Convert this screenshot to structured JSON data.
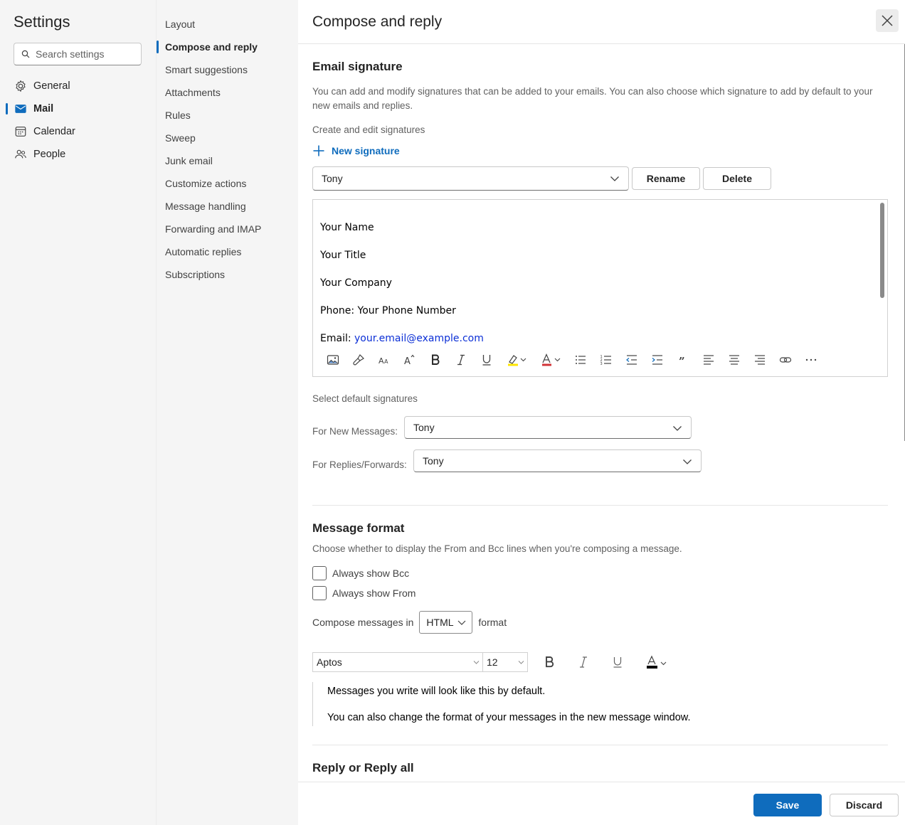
{
  "sidebar": {
    "title": "Settings",
    "search_placeholder": "Search settings",
    "items": [
      {
        "label": "General",
        "icon": "gear-icon"
      },
      {
        "label": "Mail",
        "icon": "mail-icon"
      },
      {
        "label": "Calendar",
        "icon": "calendar-icon"
      },
      {
        "label": "People",
        "icon": "people-icon"
      }
    ]
  },
  "subnav": {
    "items": [
      "Layout",
      "Compose and reply",
      "Smart suggestions",
      "Attachments",
      "Rules",
      "Sweep",
      "Junk email",
      "Customize actions",
      "Message handling",
      "Forwarding and IMAP",
      "Automatic replies",
      "Subscriptions"
    ],
    "active": "Compose and reply"
  },
  "main": {
    "title": "Compose and reply",
    "signature": {
      "heading": "Email signature",
      "description": "You can add and modify signatures that can be added to your emails. You can also choose which signature to add by default to your new emails and replies.",
      "create_label": "Create and edit signatures",
      "new_signature": "New signature",
      "selected": "Tony",
      "rename": "Rename",
      "delete": "Delete",
      "lines": [
        "Your Name",
        "Your Title",
        "Your Company",
        "Phone: Your Phone Number"
      ],
      "email_prefix": "Email: ",
      "email_value": "your.email@example.com",
      "defaults_label": "Select default signatures",
      "new_messages_label": "For New Messages:",
      "new_messages_value": "Tony",
      "replies_label": "For Replies/Forwards:",
      "replies_value": "Tony"
    },
    "format": {
      "heading": "Message format",
      "description": "Choose whether to display the From and Bcc lines when you're composing a message.",
      "show_bcc": "Always show Bcc",
      "show_from": "Always show From",
      "compose_prefix": "Compose messages in",
      "compose_value": "HTML",
      "compose_suffix": "format",
      "font": "Aptos",
      "size": "12",
      "preview_line1": "Messages you write will look like this by default.",
      "preview_line2": "You can also change the format of your messages in the new message window."
    },
    "reply": {
      "heading": "Reply or Reply all"
    }
  },
  "footer": {
    "save": "Save",
    "discard": "Discard"
  },
  "colors": {
    "accent": "#0f6cbd",
    "link": "#0b2fd6",
    "highlight": "#ffe600",
    "font_color": "#d13438"
  }
}
